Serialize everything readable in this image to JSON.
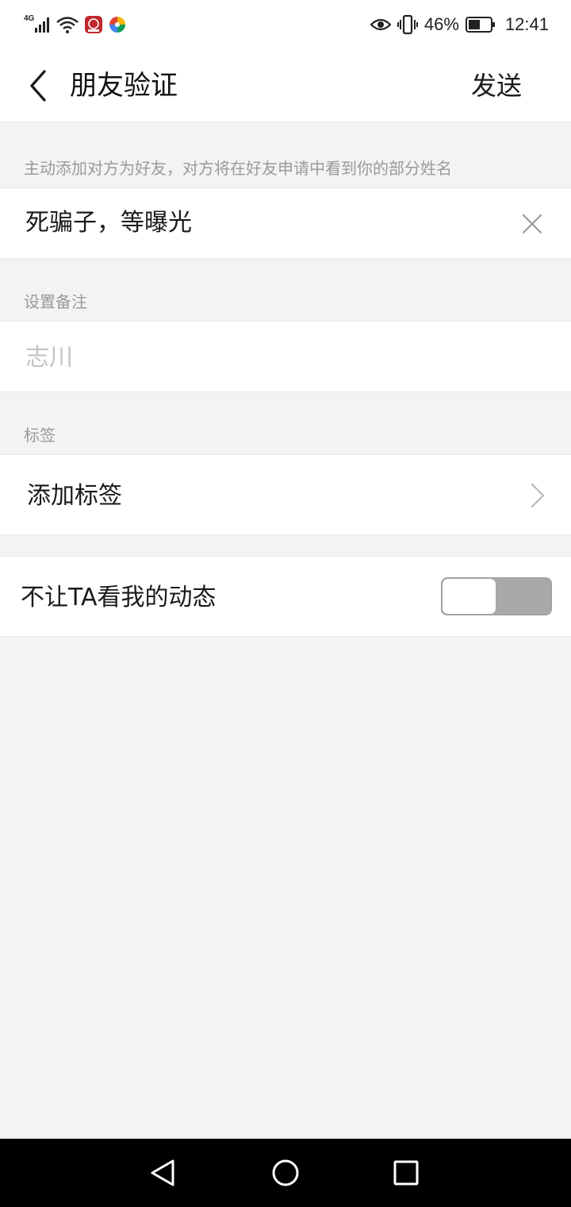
{
  "status_bar": {
    "network_type": "4G",
    "battery_percent": "46%",
    "time": "12:41",
    "icons": [
      "signal-icon",
      "wifi-icon",
      "app-notification-icon",
      "colorful-app-icon",
      "eye-icon",
      "vibrate-icon",
      "battery-icon"
    ]
  },
  "header": {
    "title": "朋友验证",
    "send_label": "发送",
    "back_icon": "chevron-left-icon"
  },
  "verification": {
    "hint": "主动添加对方为好友，对方将在好友申请中看到你的部分姓名",
    "message_value": "死骗子，等曝光",
    "clear_icon": "close-icon"
  },
  "remark": {
    "section_label": "设置备注",
    "placeholder": "志川"
  },
  "tags": {
    "section_label": "标签",
    "add_label": "添加标签",
    "arrow_icon": "chevron-right-icon"
  },
  "moments": {
    "label": "不让TA看我的动态",
    "toggle_on": false
  },
  "colors": {
    "background": "#f3f3f3",
    "surface": "#ffffff",
    "hint_text": "#9a9a9a",
    "toggle_off_track": "#a9a9a9",
    "nav_bar": "#000000"
  },
  "nav_bar": {
    "icons": [
      "back-triangle-icon",
      "home-circle-icon",
      "recents-square-icon"
    ]
  }
}
